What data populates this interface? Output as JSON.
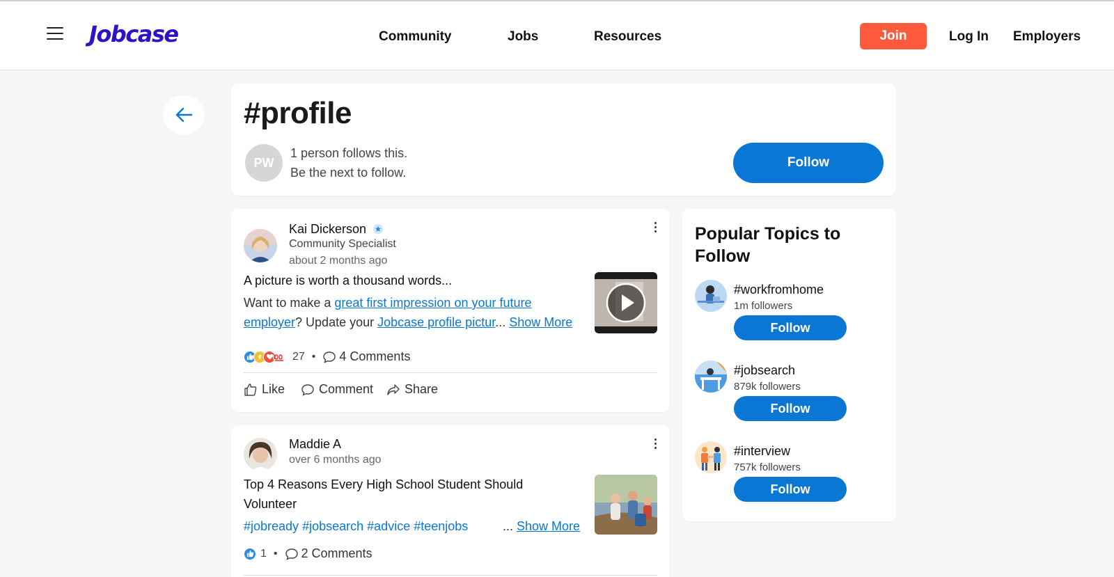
{
  "header": {
    "logo": "Jobcase",
    "nav": [
      "Community",
      "Jobs",
      "Resources"
    ],
    "join_label": "Join",
    "login_label": "Log In",
    "employers_label": "Employers"
  },
  "tag": {
    "title": "#profile",
    "avatar_initials": "PW",
    "follows_line1": "1 person follows this.",
    "follows_line2": "Be the next to follow.",
    "follow_label": "Follow"
  },
  "posts": [
    {
      "author": "Kai Dickerson",
      "role": "Community Specialist",
      "time": "about 2 months ago",
      "title": "A picture is worth a thousand words...",
      "body_prefix": "Want to make a ",
      "body_link1": "great first impression on your future employer",
      "body_mid": "? Update your ",
      "body_link2": "Jobcase profile pictur",
      "ellipsis": "...",
      "show_more": "Show More",
      "reaction_count": "27",
      "comments": "4 Comments",
      "actions": {
        "like": "Like",
        "comment": "Comment",
        "share": "Share"
      }
    },
    {
      "author": "Maddie A",
      "time": "over 6 months ago",
      "title_line1": "Top 4 Reasons Every High School Student Should",
      "title_line2": "Volunteer",
      "hashtags": [
        "#jobready",
        "#jobsearch",
        "#advice",
        "#teenjobs"
      ],
      "ellipsis": "...",
      "show_more": "Show More",
      "reaction_count": "1",
      "comments": "2 Comments"
    }
  ],
  "sidebar": {
    "title": "Popular Topics to Follow",
    "topics": [
      {
        "name": "#workfromhome",
        "followers": "1m followers",
        "follow_label": "Follow"
      },
      {
        "name": "#jobsearch",
        "followers": "879k followers",
        "follow_label": "Follow"
      },
      {
        "name": "#interview",
        "followers": "757k followers",
        "follow_label": "Follow"
      }
    ]
  },
  "colors": {
    "brand": "#2a14c4",
    "accent": "#0b77d4",
    "join": "#ff5a3c"
  }
}
